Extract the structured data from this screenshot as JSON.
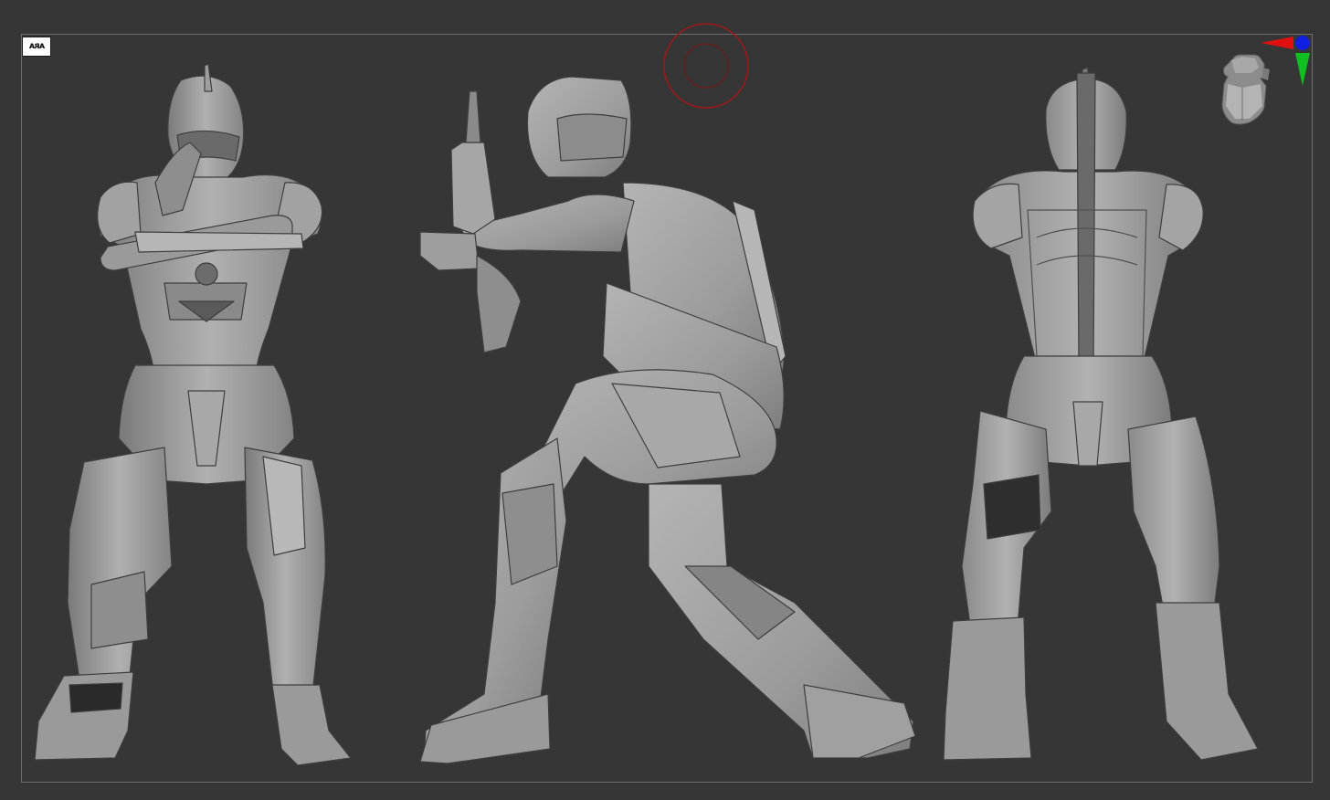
{
  "viewport": {
    "background": "#363636",
    "frame_color": "#6e6e6e",
    "model_color": "#9a9a9a"
  },
  "perspective_toggle": {
    "label": "ᴀᴙᴀ",
    "icon": "figures-icon"
  },
  "brush_cursor": {
    "color": "#a01818"
  },
  "navigation_gizmo": {
    "x_axis_color": "#e01010",
    "y_axis_color": "#10c020",
    "z_axis_color": "#1020e0",
    "icon": "head-orientation-icon"
  },
  "model_views": [
    {
      "view": "front",
      "icon": "armored-figure-front"
    },
    {
      "view": "side",
      "icon": "armored-figure-side"
    },
    {
      "view": "back",
      "icon": "armored-figure-back"
    }
  ]
}
